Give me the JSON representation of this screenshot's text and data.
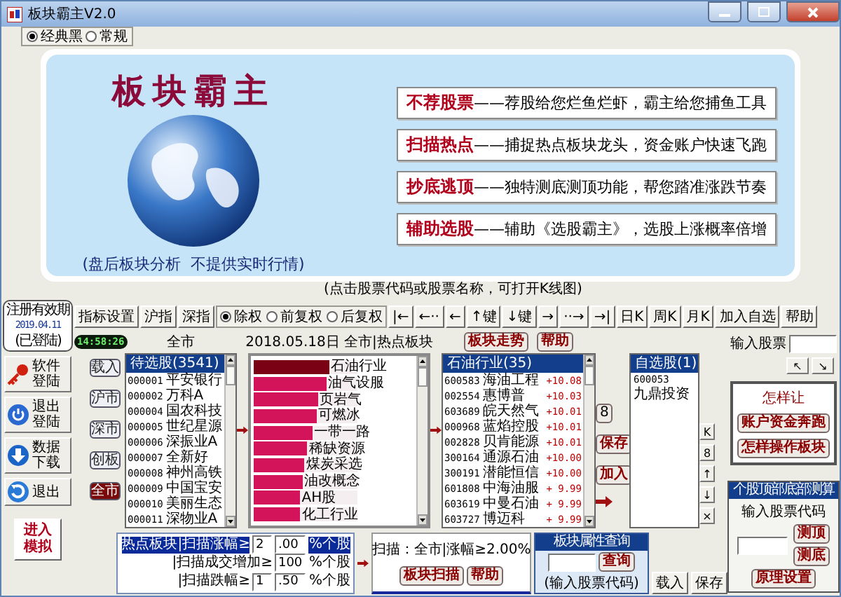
{
  "window": {
    "title": "板块霸主V2.0"
  },
  "theme_options": [
    {
      "label": "经典黑",
      "selected": true
    },
    {
      "label": "常规",
      "selected": false
    }
  ],
  "banner": {
    "title": "板块霸主",
    "caption": "(盘后板块分析  不提供实时行情)",
    "features": [
      {
        "title": "不荐股票",
        "text": "——荐股给您烂鱼烂虾，霸主给您捕鱼工具"
      },
      {
        "title": "扫描热点",
        "text": "——捕捉热点板块龙头，资金账户快速飞跑"
      },
      {
        "title": "抄底逃顶",
        "text": "——独特测底测顶功能，帮您踏准涨跌节奏"
      },
      {
        "title": "辅助选股",
        "text": "——辅助《选股霸主》，选股上涨概率倍增"
      }
    ]
  },
  "hint": "(点击股票代码或股票名称，可打开K线图)",
  "registration": {
    "label": "注册有效期",
    "date": "2019.04.11",
    "status": "(已登陆)"
  },
  "clock": "14:58:26",
  "side_buttons": [
    {
      "label": "软件登陆",
      "kind": "key"
    },
    {
      "label": "退出登陆",
      "kind": "off"
    },
    {
      "label": "数据下载",
      "kind": "download"
    },
    {
      "label": "退出",
      "kind": "exit"
    }
  ],
  "simulate_button": "进入模拟",
  "toolbar": {
    "buttons": [
      "指标设置",
      "沪指",
      "深指"
    ],
    "adjust": [
      {
        "label": "除权",
        "selected": true
      },
      {
        "label": "前复权",
        "selected": false
      },
      {
        "label": "后复权",
        "selected": false
      }
    ],
    "nav": [
      "|←",
      "←··",
      "←",
      "↑键",
      "↓键",
      "→",
      "··→",
      "→|"
    ],
    "periods": [
      "日K",
      "周K",
      "月K"
    ],
    "actions": [
      "加入自选",
      "帮助"
    ]
  },
  "quote_input": {
    "label": "输入股票",
    "arrows": [
      "↖",
      "↘"
    ]
  },
  "market_buttons": [
    {
      "label": "载入",
      "selected": false
    },
    {
      "label": "沪市",
      "selected": false
    },
    {
      "label": "深市",
      "selected": false
    },
    {
      "label": "创板",
      "selected": false
    },
    {
      "label": "全市",
      "selected": true
    }
  ],
  "candidates": {
    "label": "全市",
    "header": "待选股(3541)",
    "rows": [
      {
        "code": "000001",
        "name": "平安银行"
      },
      {
        "code": "000002",
        "name": "万科A"
      },
      {
        "code": "000004",
        "name": "国农科技"
      },
      {
        "code": "000005",
        "name": "世纪星源"
      },
      {
        "code": "000006",
        "name": "深振业A"
      },
      {
        "code": "000007",
        "name": "全新好"
      },
      {
        "code": "000008",
        "name": "神州高铁"
      },
      {
        "code": "000009",
        "name": "中国宝安"
      },
      {
        "code": "000010",
        "name": "美丽生态"
      },
      {
        "code": "000011",
        "name": "深物业A"
      }
    ]
  },
  "hot_sectors": {
    "title": "2018.05.18日 全市|热点板块",
    "bars": [
      {
        "name": "石油行业",
        "level": 0.73,
        "selected": true
      },
      {
        "name": "油气设服",
        "level": 0.7,
        "selected": false
      },
      {
        "name": "页岩气",
        "level": 0.62,
        "selected": false
      },
      {
        "name": "可燃冰",
        "level": 0.61,
        "selected": false
      },
      {
        "name": "一带一路",
        "level": 0.57,
        "selected": false
      },
      {
        "name": "稀缺资源",
        "level": 0.52,
        "selected": false
      },
      {
        "name": "煤炭采选",
        "level": 0.49,
        "selected": false
      },
      {
        "name": "油改概念",
        "level": 0.47,
        "selected": false
      },
      {
        "name": "AH股",
        "level": 0.45,
        "selected": false
      },
      {
        "name": "化工行业",
        "level": 0.45,
        "selected": false
      }
    ]
  },
  "sector_buttons": [
    "板块走势",
    "帮助"
  ],
  "sector_stocks": {
    "header": "石油行业(35)",
    "rows": [
      {
        "code": "600583",
        "name": "海油工程",
        "change": "+10.08"
      },
      {
        "code": "002554",
        "name": "惠博普",
        "change": "+10.03"
      },
      {
        "code": "603689",
        "name": "皖天然气",
        "change": "+10.01"
      },
      {
        "code": "000968",
        "name": "蓝焰控股",
        "change": "+10.01"
      },
      {
        "code": "002828",
        "name": "贝肯能源",
        "change": "+10.01"
      },
      {
        "code": "300164",
        "name": "通源石油",
        "change": "+10.00"
      },
      {
        "code": "300191",
        "name": "潜能恒信",
        "change": "+10.00"
      },
      {
        "code": "601808",
        "name": "中海油服",
        "change": "+ 9.99"
      },
      {
        "code": "603619",
        "name": "中曼石油",
        "change": "+ 9.99"
      },
      {
        "code": "603727",
        "name": "博迈科",
        "change": "+ 9.99"
      }
    ]
  },
  "middle_buttons": [
    "8",
    "保存",
    "加入"
  ],
  "watchlist": {
    "header": "自选股(1)",
    "rows": [
      {
        "code": "600053",
        "name": "九鼎投资"
      }
    ],
    "buttons": [
      "载入",
      "保存"
    ]
  },
  "watchlist_tools": [
    "K",
    "8",
    "↑",
    "↓",
    "×"
  ],
  "promo": {
    "text": "怎样让",
    "buttons": [
      "账户资金奔跑",
      "怎样操作板块"
    ]
  },
  "scan_settings": {
    "rows": [
      {
        "label": "热点板块|扫描涨幅≥",
        "fields": [
          "2",
          ".00"
        ],
        "unit": "%个股",
        "selected": true
      },
      {
        "label": "|扫描成交增加≥",
        "fields": [
          "100"
        ],
        "unit": "%个股",
        "selected": false
      },
      {
        "label": "|扫描跌幅≥",
        "fields": [
          "1",
          ".50"
        ],
        "unit": "%个股",
        "selected": false
      }
    ]
  },
  "scan_result": {
    "text": "扫描：全市|涨幅≥2.00%",
    "buttons": [
      "板块扫描",
      "帮助"
    ]
  },
  "sector_query": {
    "title": "板块属性查询",
    "button": "查询",
    "hint": "(输入股票代码)"
  },
  "top_bottom": {
    "title": "个股顶部底部测算",
    "label": "输入股票代码",
    "buttons": [
      "测顶",
      "测底",
      "原理设置"
    ]
  }
}
